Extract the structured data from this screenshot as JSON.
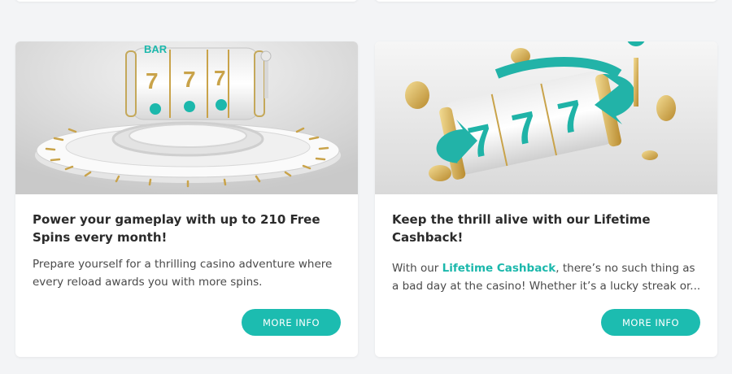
{
  "cards": [
    {
      "title": "Power your gameplay with up to 210 Free Spins every month!",
      "text": "Prepare yourself for a thrilling casino adventure where every reload awards you with more spins.",
      "button": "MORE INFO",
      "image_alt_icon": "slot-machine-wheel-icon",
      "reel_symbols": [
        "BAR",
        "7",
        "7",
        "7"
      ]
    },
    {
      "title": "Keep the thrill alive with our Lifetime Cashback!",
      "text_before": "With our ",
      "text_link": "Lifetime Cashback",
      "text_after": ", there’s no such thing as a bad day at the casino! Whether it’s a lucky streak or...",
      "button": "MORE INFO",
      "image_alt_icon": "slot-machine-cashback-icon",
      "reel_symbols": [
        "7",
        "7",
        "7"
      ]
    }
  ],
  "colors": {
    "accent": "#1cbcb0",
    "background": "#f3f4f6",
    "card": "#ffffff"
  }
}
